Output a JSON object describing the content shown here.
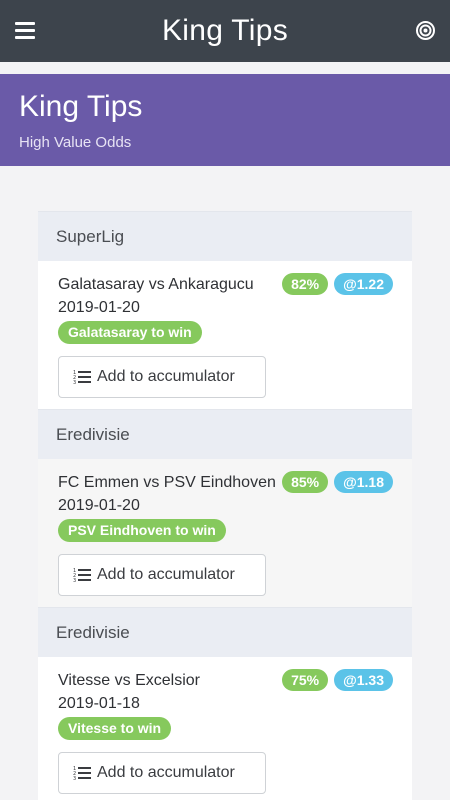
{
  "topbar": {
    "title": "King Tips",
    "menu_icon": "hamburger-menu-icon",
    "target_icon": "target-icon"
  },
  "hero": {
    "title": "King Tips",
    "subtitle": "High Value Odds"
  },
  "colors": {
    "topbar": "#3d444c",
    "hero": "#6a5aa8",
    "percent_badge": "#86c95d",
    "odds_badge": "#5bc3e8",
    "pick_badge": "#86c95d"
  },
  "tips": [
    {
      "league": "SuperLig",
      "match": "Galatasaray vs Ankaragucu",
      "date": "2019-01-20",
      "probability": "82%",
      "odds": "@1.22",
      "pick": "Galatasaray to win",
      "button_label": "Add to accumulator",
      "button_icon": "numbered-list-icon"
    },
    {
      "league": "Eredivisie",
      "match": "FC Emmen vs PSV Eindhoven",
      "date": "2019-01-20",
      "probability": "85%",
      "odds": "@1.18",
      "pick": "PSV Eindhoven to win",
      "button_label": "Add to accumulator",
      "button_icon": "numbered-list-icon"
    },
    {
      "league": "Eredivisie",
      "match": "Vitesse vs Excelsior",
      "date": "2019-01-18",
      "probability": "75%",
      "odds": "@1.33",
      "pick": "Vitesse to win",
      "button_label": "Add to accumulator",
      "button_icon": "numbered-list-icon"
    }
  ]
}
